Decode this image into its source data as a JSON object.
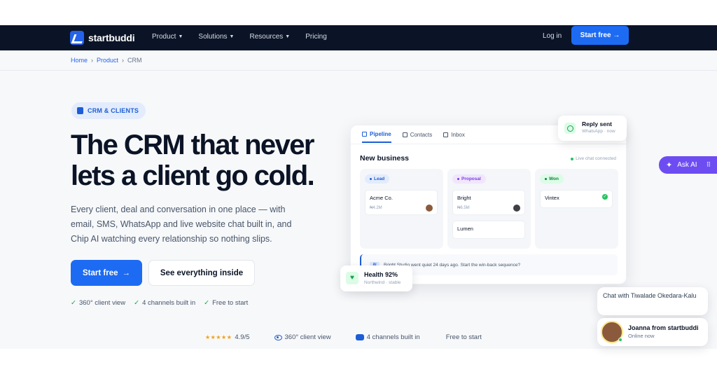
{
  "nav": {
    "brand": "startbuddi",
    "items": [
      {
        "label": "Product",
        "dropdown": true
      },
      {
        "label": "Solutions",
        "dropdown": true
      },
      {
        "label": "Resources",
        "dropdown": true
      },
      {
        "label": "Pricing",
        "dropdown": false
      }
    ],
    "login": "Log in",
    "cta": "Start free →"
  },
  "breadcrumb": [
    "Home",
    "Product",
    "CRM"
  ],
  "breadcrumb_sep": "›",
  "hero": {
    "pill": "CRM & CLIENTS",
    "headline": "The CRM that never lets a client go cold.",
    "subtext": "Every client, deal and conversation in one place — with email, SMS, WhatsApp and live website chat built in, and Chip AI watching every relationship so nothing slips.",
    "primary_btn": "Start free",
    "primary_arrow": "→",
    "secondary_btn": "See everything inside",
    "checks": [
      "360° client view",
      "4 channels built in",
      "Free to start"
    ]
  },
  "stats": {
    "stars": "★★★★★",
    "rating": "4.9/5",
    "s1": "360° client view",
    "s2": "4 channels built in",
    "s3": "Free to start"
  },
  "mock": {
    "tabs": [
      "Pipeline",
      "Contacts",
      "Inbox"
    ],
    "title": "New business",
    "live": "Live chat connected",
    "columns": [
      {
        "tag": "Lead",
        "cards": [
          {
            "name": "Acme Co.",
            "value": "₦4.2M"
          }
        ]
      },
      {
        "tag": "Proposal",
        "cards": [
          {
            "name": "Bright",
            "value": "₦6.5M"
          },
          {
            "name": "Lumen",
            "value": ""
          }
        ]
      },
      {
        "tag": "Won",
        "cards": [
          {
            "name": "Vintex",
            "value": ""
          }
        ]
      }
    ],
    "alert_badge": "AI",
    "alert": "Bright Studio went quiet 24 days ago. Start the win-back sequence?"
  },
  "reply": {
    "title": "Reply sent",
    "sub": "WhatsApp · now"
  },
  "health": {
    "title": "Health 92%",
    "sub": "Northwind · stable"
  },
  "askai": {
    "label": "Ask AI"
  },
  "chat": {
    "bubble": "Chat with Tiwalade Okedara-Kalu",
    "agent": "Joanna from startbuddi",
    "status": "Online now"
  },
  "colors": {
    "nav_bg": "#0b1426",
    "primary": "#1d6bf3",
    "askai": "#6d4df2"
  }
}
